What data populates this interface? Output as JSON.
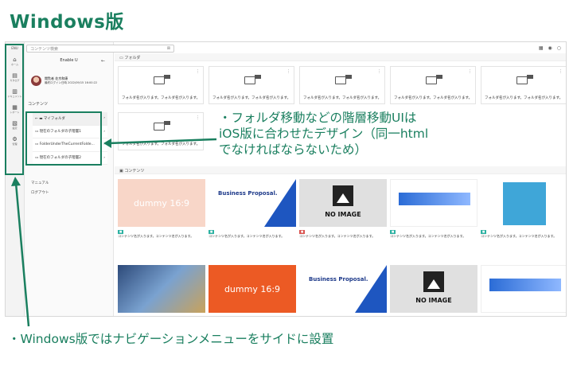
{
  "page_title": "Windows版",
  "annotation_folder": "・フォルダ移動などの階層移動UIは\niOS版に合わせたデザイン（同一html\nでなければならないため）",
  "annotation_nav": "・Windows版ではナビゲーションメニューをサイドに設置",
  "app": {
    "search_placeholder": "コンテンツ検索",
    "panel_header": "Enable U",
    "user": {
      "role": "閲覧者",
      "name": "佐京和康",
      "last_login": "最終ログイン日時 2022/09/15 16:00:22"
    },
    "contents_heading": "コンテンツ",
    "folders": [
      "マイフォルダ",
      "現在のフォルダの子階層1",
      "FolderUnderTheCurrentFolde...",
      "現在のフォルダの子階層2"
    ],
    "extra_items": [
      "マニュアル",
      "ログアウト"
    ],
    "rail": [
      {
        "icon": "⌂",
        "label": "ホーム"
      },
      {
        "icon": "▤",
        "label": "カタログ"
      },
      {
        "icon": "▥",
        "label": "ドキュメント"
      },
      {
        "icon": "▦",
        "label": "レポート"
      },
      {
        "icon": "▧",
        "label": "設定"
      },
      {
        "icon": "⚙",
        "label": "管理"
      }
    ],
    "folder_section": "フォルダ",
    "folder_label": "フォルダ名が入ります。フォルダ名が入ります。",
    "content_section": "コンテンツ",
    "content_meta": "コンテンツ名が入ります。コンテンツ名が入ります。",
    "dummy_text": "dummy 16:9",
    "biz_text": "Business Proposal.",
    "noimage_text": "NO IMAGE"
  }
}
